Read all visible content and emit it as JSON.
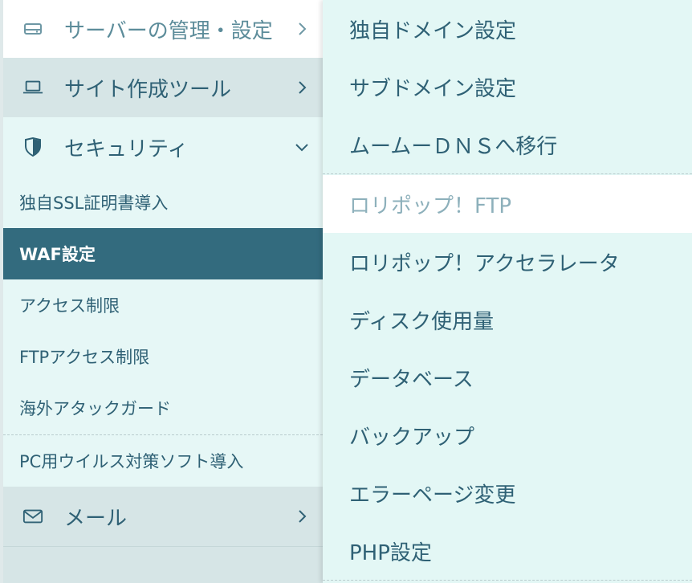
{
  "sidebar": {
    "categories": [
      {
        "label": "サーバーの管理・設定",
        "icon": "server-icon",
        "chevron": "chevron-right-icon"
      },
      {
        "label": "サイト作成ツール",
        "icon": "laptop-icon",
        "chevron": "chevron-right-icon"
      },
      {
        "label": "セキュリティ",
        "icon": "shield-icon",
        "chevron": "chevron-down-icon"
      },
      {
        "label": "メール",
        "icon": "mail-icon",
        "chevron": "chevron-right-icon"
      }
    ],
    "security_items": [
      {
        "label": "独自SSL証明書導入"
      },
      {
        "label": "WAF設定",
        "active": true
      },
      {
        "label": "アクセス制限"
      },
      {
        "label": "FTPアクセス制限"
      },
      {
        "label": "海外アタックガード"
      },
      {
        "label": "PC用ウイルス対策ソフト導入"
      }
    ]
  },
  "flyout": {
    "items": [
      {
        "label": "独自ドメイン設定"
      },
      {
        "label": "サブドメイン設定"
      },
      {
        "label": "ムームーＤＮＳへ移行"
      },
      {
        "label": "ロリポップ！FTP",
        "hover": true
      },
      {
        "label": "ロリポップ！アクセラレータ"
      },
      {
        "label": "ディスク使用量"
      },
      {
        "label": "データベース"
      },
      {
        "label": "バックアップ"
      },
      {
        "label": "エラーページ変更"
      },
      {
        "label": "PHP設定"
      }
    ]
  },
  "colors": {
    "active_bg": "#336b7e",
    "text": "#2f6175",
    "sidebar_bg": "#e6f7f6",
    "category_bg": "#d6e5e6",
    "flyout_bg": "#e3f7f5",
    "hover_text": "#8db0bb"
  }
}
